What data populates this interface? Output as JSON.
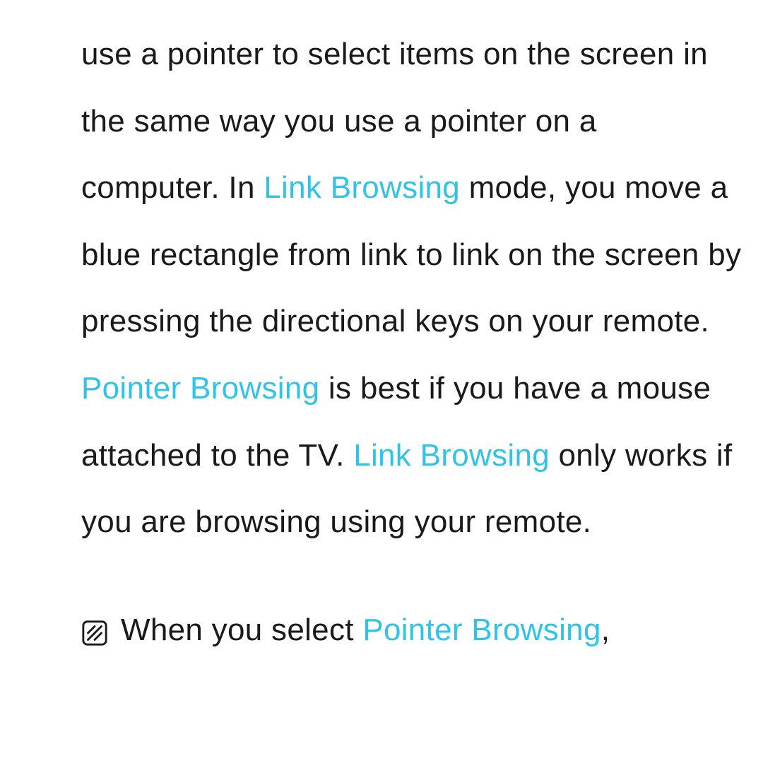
{
  "colors": {
    "highlight": "#2fc3e8",
    "text": "#1a1a1a"
  },
  "para": {
    "seg1": "use a pointer to select items on the screen in the same way you use a pointer on a computer. In ",
    "hl1": "Link Browsing",
    "seg2": " mode, you move a blue rectangle from link to link on the screen by pressing the directional keys on your remote. ",
    "hl2": "Pointer Browsing",
    "seg3": " is best if you have a mouse attached to the TV. ",
    "hl3": "Link Browsing",
    "seg4": " only works if you are browsing using your remote."
  },
  "note": {
    "icon_name": "note-icon",
    "seg1": "When you select ",
    "hl1": "Pointer Browsing",
    "seg2": ","
  }
}
